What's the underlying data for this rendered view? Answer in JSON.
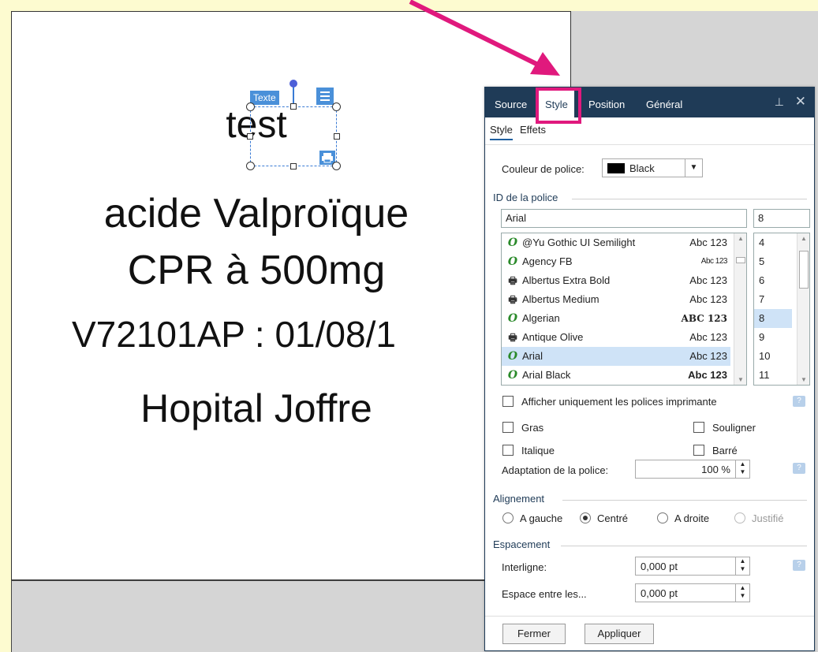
{
  "canvas": {
    "selected_text": "test",
    "tag_label": "Texte",
    "lines": [
      "acide Valproïque",
      "CPR à 500mg",
      "V72101AP : 01/08/1",
      "Hopital Joffre"
    ]
  },
  "panel": {
    "tabs": [
      "Source",
      "Style",
      "Position",
      "Général"
    ],
    "subtabs": [
      "Style",
      "Effets"
    ],
    "font_color_label": "Couleur de police:",
    "font_color_value": "Black",
    "font_id_section": "ID de la police",
    "font_name_value": "Arial",
    "font_size_value": "8",
    "fonts": [
      {
        "icon": "opentype-icon",
        "name": "@Yu Gothic UI Semilight",
        "preview": "Abc 123"
      },
      {
        "icon": "opentype-icon",
        "name": "Agency FB",
        "preview": "Abc 123"
      },
      {
        "icon": "printer-font-icon",
        "name": "Albertus Extra Bold",
        "preview": "Abc 123"
      },
      {
        "icon": "printer-font-icon",
        "name": "Albertus Medium",
        "preview": "Abc 123"
      },
      {
        "icon": "opentype-icon",
        "name": "Algerian",
        "preview": "ABC 123"
      },
      {
        "icon": "printer-font-icon",
        "name": "Antique Olive",
        "preview": "Abc 123"
      },
      {
        "icon": "opentype-icon",
        "name": "Arial",
        "preview": "Abc 123"
      },
      {
        "icon": "opentype-icon",
        "name": "Arial Black",
        "preview": "Abc 123"
      }
    ],
    "selected_font_index": 6,
    "sizes": [
      "4",
      "5",
      "6",
      "7",
      "8",
      "9",
      "10",
      "11"
    ],
    "selected_size_index": 4,
    "printer_fonts_only_label": "Afficher uniquement les polices imprimante",
    "bold_label": "Gras",
    "underline_label": "Souligner",
    "italic_label": "Italique",
    "strikeout_label": "Barré",
    "font_scale_label": "Adaptation de la police:",
    "font_scale_value": "100 %",
    "alignment_section": "Alignement",
    "align_left": "A gauche",
    "align_center": "Centré",
    "align_right": "A droite",
    "align_justify": "Justifié",
    "spacing_section": "Espacement",
    "line_spacing_label": "Interligne:",
    "line_spacing_value": "0,000 pt",
    "char_spacing_label": "Espace entre les...",
    "char_spacing_value": "0,000 pt",
    "close_button": "Fermer",
    "apply_button": "Appliquer"
  },
  "colors": {
    "panel_header": "#1f3b57",
    "highlight": "#e0197d",
    "selection": "#3a7bd5"
  }
}
